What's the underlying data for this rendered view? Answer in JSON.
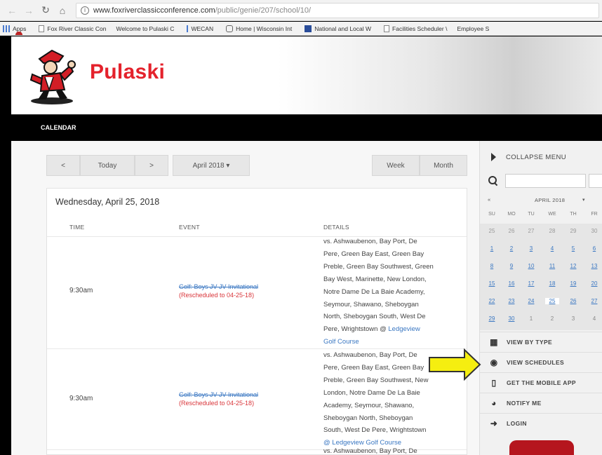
{
  "browser": {
    "url_domain": "www.foxriverclassicconference.com",
    "url_path": "/public/genie/207/school/10/",
    "bookmarks": [
      {
        "icon": "apps-icon",
        "label": "Apps"
      },
      {
        "icon": "page-icon",
        "label": "Fox River Classic Con"
      },
      {
        "icon": "mascot-icon",
        "label": "Welcome to Pulaski C"
      },
      {
        "icon": "page-icon",
        "label": "WECAN"
      },
      {
        "icon": "home-icon",
        "label": "Home | Wisconsin Int"
      },
      {
        "icon": "nat-icon",
        "label": "National and Local W"
      },
      {
        "icon": "page-icon",
        "label": "Facilities Scheduler \\"
      },
      {
        "icon": "mascot-icon",
        "label": "Employee S"
      }
    ]
  },
  "site": {
    "name": "Pulaski",
    "brand_color": "#e4222c",
    "nav_item": "CALENDAR"
  },
  "toolbar": {
    "prev": "<",
    "today": "Today",
    "next": ">",
    "month_select": "April 2018 ▾",
    "week": "Week",
    "month": "Month"
  },
  "agenda": {
    "day_header": "Wednesday, April 25, 2018",
    "columns": [
      "TIME",
      "EVENT",
      "DETAILS"
    ],
    "rows": [
      {
        "time": "9:30am",
        "event": "Golf: Boys JV JV Invitational",
        "rescheduled": "(Rescheduled to 04-25-18)",
        "details_lines": [
          "vs. Ashwaubenon, Bay Port, De",
          "Pere, Green Bay East, Green Bay",
          "Preble, Green Bay Southwest, Green",
          "Bay West, Marinette, New London,",
          "Notre Dame De La Baie Academy,",
          "Seymour, Shawano, Sheboygan",
          "North, Sheboygan South, West De"
        ],
        "details_tail": "Pere, Wrightstown @",
        "location_a": "Ledgeview",
        "location_b": "Golf Course"
      },
      {
        "time": "9:30am",
        "event": "Golf: Boys JV JV Invitational",
        "rescheduled": "(Rescheduled to 04-25-18)",
        "details_lines": [
          "vs. Ashwaubenon, Bay Port, De",
          "Pere, Green Bay East, Green Bay",
          "Preble, Green Bay Southwest, New",
          "London, Notre Dame De La Baie",
          "Academy, Seymour, Shawano,",
          "Sheboygan North, Sheboygan",
          "South, West De Pere, Wrightstown"
        ],
        "location": "@ Ledgeview Golf Course"
      },
      {
        "partial_detail": "vs. Ashwaubenon, Bay Port, De"
      }
    ]
  },
  "sidebar": {
    "collapse_label": "COLLAPSE MENU",
    "cal_prev": "«",
    "cal_month": "APRIL 2018",
    "cal_dropdown": "▾",
    "dow": [
      "SU",
      "MO",
      "TU",
      "WE",
      "TH",
      "FR"
    ],
    "weeks": [
      [
        "25",
        "26",
        "27",
        "28",
        "29",
        "30"
      ],
      [
        "1",
        "2",
        "3",
        "4",
        "5",
        "6"
      ],
      [
        "8",
        "9",
        "10",
        "11",
        "12",
        "13"
      ],
      [
        "15",
        "16",
        "17",
        "18",
        "19",
        "20"
      ],
      [
        "22",
        "23",
        "24",
        "25",
        "26",
        "27"
      ],
      [
        "29",
        "30",
        "1",
        "2",
        "3",
        "4"
      ]
    ],
    "menu": [
      {
        "icon": "calendar-icon",
        "label": "VIEW BY TYPE"
      },
      {
        "icon": "eye-icon",
        "label": "VIEW SCHEDULES"
      },
      {
        "icon": "mobile-icon",
        "label": "GET THE MOBILE APP"
      },
      {
        "icon": "bell-icon",
        "label": "NOTIFY ME"
      },
      {
        "icon": "login-icon",
        "label": "LOGIN"
      }
    ]
  },
  "annotation": {
    "arrow_color": "#f5ee10",
    "arrow_outline": "#333333"
  }
}
